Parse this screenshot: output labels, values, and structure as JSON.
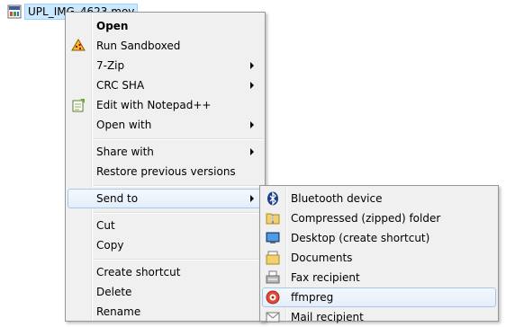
{
  "desktop": {
    "file_name": "UPL_IMG_4623.mov"
  },
  "context_menu": {
    "open": "Open",
    "run_sandboxed": "Run Sandboxed",
    "seven_zip": "7-Zip",
    "crc_sha": "CRC SHA",
    "edit_notepad": "Edit with Notepad++",
    "open_with": "Open with",
    "share_with": "Share with",
    "restore_previous": "Restore previous versions",
    "send_to": "Send to",
    "cut": "Cut",
    "copy": "Copy",
    "create_shortcut": "Create shortcut",
    "delete": "Delete",
    "rename": "Rename"
  },
  "send_to_menu": {
    "bluetooth": "Bluetooth device",
    "compressed": "Compressed (zipped) folder",
    "desktop": "Desktop (create shortcut)",
    "documents": "Documents",
    "fax": "Fax recipient",
    "ffmpreg": "ffmpreg",
    "mail": "Mail recipient"
  },
  "icons": {
    "file": "video-file-icon",
    "sandboxie": "sandboxie-icon",
    "notepad": "notepad-plus-plus-icon",
    "bluetooth": "bluetooth-icon",
    "zip_folder": "zip-folder-icon",
    "desktop": "desktop-icon",
    "documents": "documents-icon",
    "fax": "fax-icon",
    "ffmpreg": "ffmpreg-icon",
    "mail": "mail-icon"
  }
}
